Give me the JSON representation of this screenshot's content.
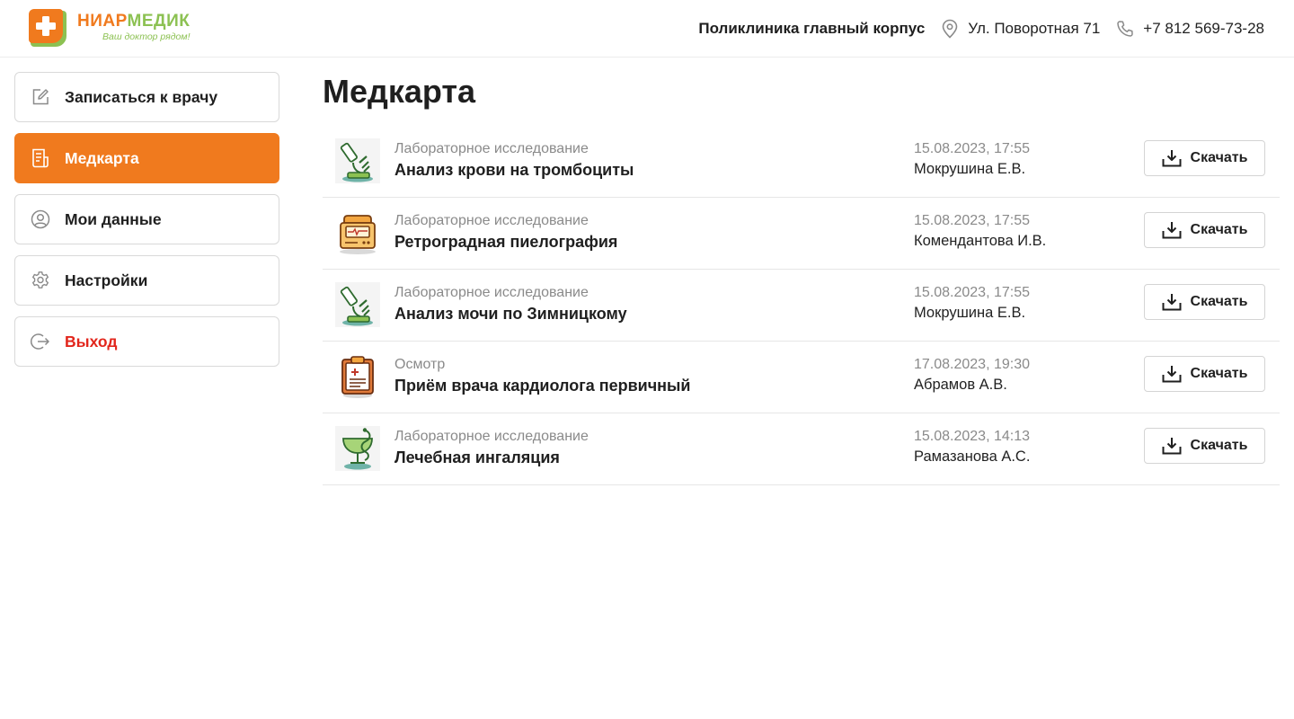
{
  "header": {
    "logo": {
      "name_part1": "НИАР",
      "name_part2": "МЕДИК",
      "tagline": "Ваш доктор рядом!"
    },
    "clinic": "Поликлиника главный корпус",
    "address": "Ул. Поворотная 71",
    "phone": "+7 812 569-73-28"
  },
  "sidebar": {
    "items": [
      {
        "label": "Записаться к врачу",
        "icon": "edit-icon"
      },
      {
        "label": "Медкарта",
        "icon": "document-icon",
        "active": true
      },
      {
        "label": "Мои данные",
        "icon": "user-circle-icon"
      },
      {
        "label": "Настройки",
        "icon": "gear-icon"
      },
      {
        "label": "Выход",
        "icon": "logout-icon"
      }
    ]
  },
  "main": {
    "title": "Медкарта",
    "download_label": "Скачать",
    "records": [
      {
        "type": "Лабораторное исследование",
        "name": "Анализ крови на тромбоциты",
        "date": "15.08.2023, 17:55",
        "doctor": "Мокрушина Е.В.",
        "icon": "microscope-icon"
      },
      {
        "type": "Лабораторное исследование",
        "name": "Ретроградная пиелография",
        "date": "15.08.2023, 17:55",
        "doctor": "Комендантова И.В.",
        "icon": "monitor-device-icon"
      },
      {
        "type": "Лабораторное исследование",
        "name": "Анализ мочи по Зимницкому",
        "date": "15.08.2023, 17:55",
        "doctor": "Мокрушина Е.В.",
        "icon": "microscope-icon"
      },
      {
        "type": "Осмотр",
        "name": "Приём врача кардиолога первичный",
        "date": "17.08.2023, 19:30",
        "doctor": "Абрамов А.В.",
        "icon": "clipboard-icon"
      },
      {
        "type": "Лабораторное исследование",
        "name": "Лечебная ингаляция",
        "date": "15.08.2023, 14:13",
        "doctor": "Рамазанова А.С.",
        "icon": "pharmacy-bowl-icon"
      }
    ]
  },
  "colors": {
    "accent": "#f07a1e",
    "brand_green": "#8cc152",
    "danger": "#e2261c"
  }
}
